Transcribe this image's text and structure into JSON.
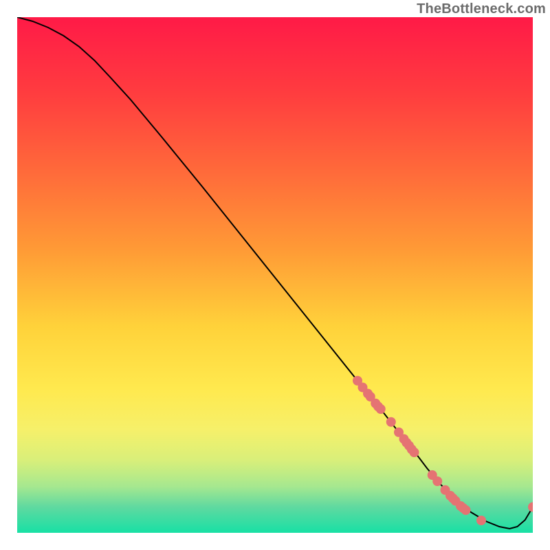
{
  "watermark": "TheBottleneck.com",
  "chart_data": {
    "type": "line",
    "title": "",
    "xlabel": "",
    "ylabel": "",
    "xlim": [
      0,
      100
    ],
    "ylim": [
      0,
      100
    ],
    "grid": false,
    "legend": false,
    "background_gradient": {
      "stops": [
        {
          "offset": 0.0,
          "color": "#ff1a47"
        },
        {
          "offset": 0.15,
          "color": "#ff3d3f"
        },
        {
          "offset": 0.3,
          "color": "#ff6a3a"
        },
        {
          "offset": 0.45,
          "color": "#ff9a36"
        },
        {
          "offset": 0.6,
          "color": "#ffd23a"
        },
        {
          "offset": 0.72,
          "color": "#ffe94e"
        },
        {
          "offset": 0.8,
          "color": "#f6f06a"
        },
        {
          "offset": 0.86,
          "color": "#d8ef7a"
        },
        {
          "offset": 0.91,
          "color": "#a6e88f"
        },
        {
          "offset": 0.95,
          "color": "#5fd9a0"
        },
        {
          "offset": 1.0,
          "color": "#18e0a5"
        }
      ]
    },
    "series": [
      {
        "name": "curve",
        "color": "#000000",
        "type": "line",
        "x": [
          0.0,
          3.0,
          6.0,
          9.0,
          12.0,
          15.0,
          18.0,
          22.0,
          28.0,
          36.0,
          44.0,
          52.0,
          60.0,
          66.0,
          70.5,
          74.0,
          77.0,
          79.5,
          82.0,
          85.0,
          88.0,
          91.0,
          93.5,
          95.5,
          97.0,
          98.5,
          100.0
        ],
        "y": [
          100.0,
          99.2,
          98.0,
          96.4,
          94.3,
          91.6,
          88.4,
          84.0,
          76.8,
          67.0,
          57.0,
          47.0,
          37.0,
          29.5,
          24.0,
          19.5,
          15.8,
          12.5,
          9.5,
          6.5,
          4.0,
          2.2,
          1.2,
          0.8,
          1.2,
          2.5,
          5.0
        ]
      },
      {
        "name": "markers",
        "color": "#e57373",
        "type": "scatter",
        "x": [
          66.0,
          67.0,
          68.0,
          68.5,
          69.5,
          70.0,
          70.5,
          72.5,
          74.0,
          75.0,
          75.5,
          76.0,
          76.5,
          77.0,
          80.5,
          81.5,
          83.0,
          84.0,
          84.5,
          85.0,
          86.0,
          86.5,
          87.0,
          90.0,
          100.0
        ],
        "y": [
          29.5,
          28.2,
          27.0,
          26.4,
          25.1,
          24.5,
          24.0,
          21.5,
          19.5,
          18.2,
          17.5,
          16.9,
          16.2,
          15.6,
          11.2,
          10.0,
          8.3,
          7.2,
          6.7,
          6.2,
          5.2,
          4.8,
          4.4,
          2.4,
          5.0
        ]
      }
    ]
  }
}
